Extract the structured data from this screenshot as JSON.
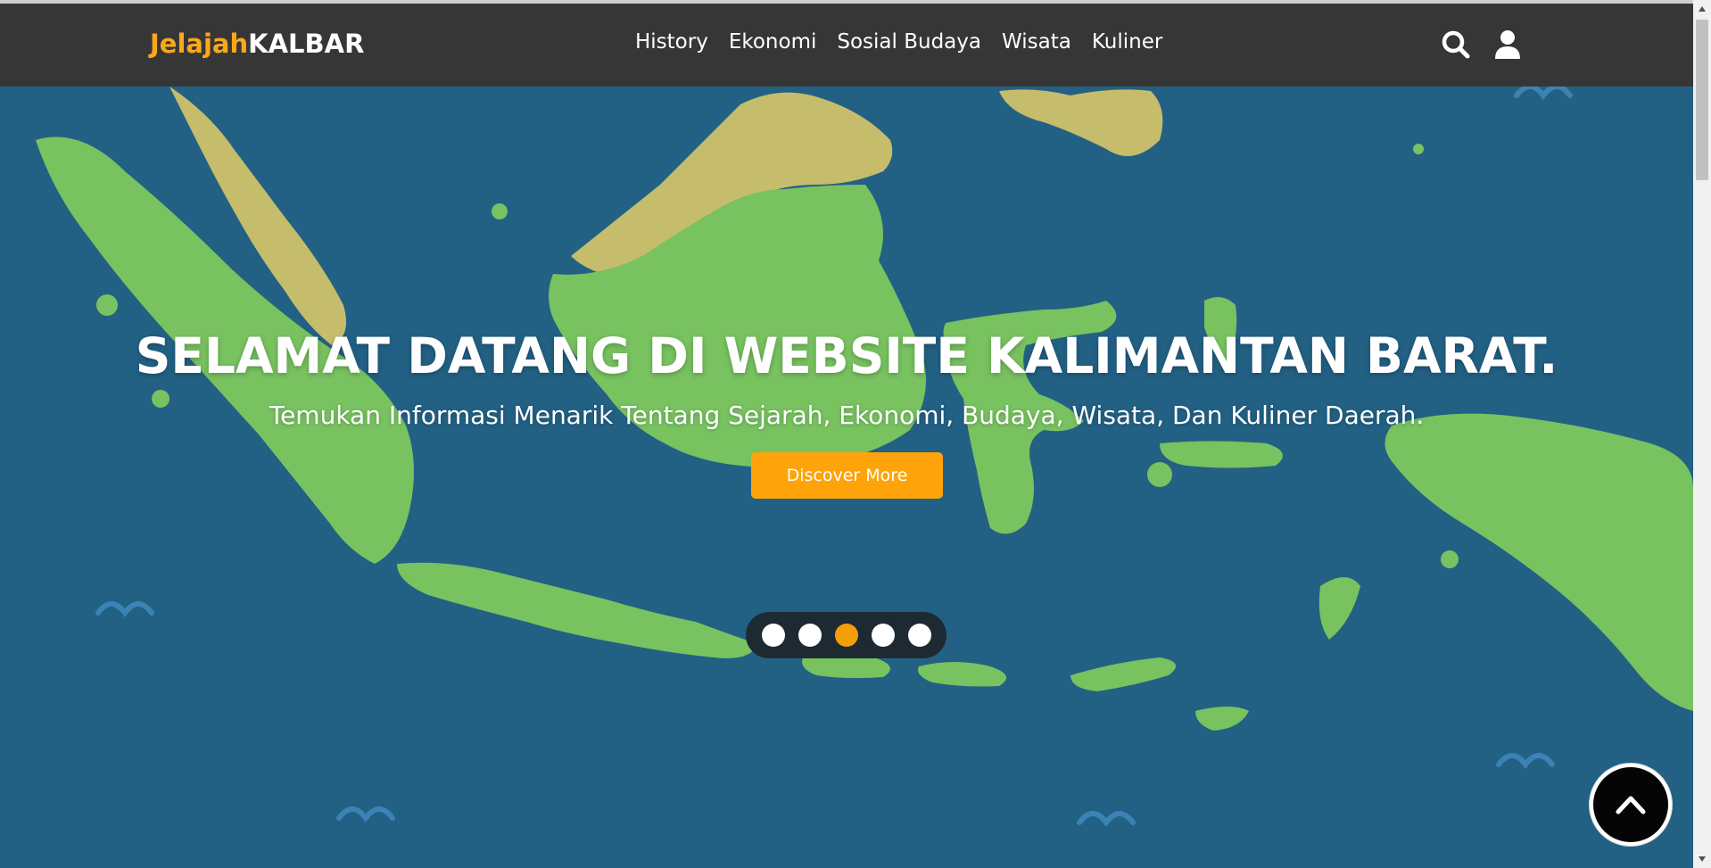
{
  "brand": {
    "part1": "Jelajah",
    "part2": "KALBAR"
  },
  "nav": {
    "links": [
      "History",
      "Ekonomi",
      "Sosial Budaya",
      "Wisata",
      "Kuliner"
    ],
    "search_icon": "search-icon",
    "user_icon": "user-icon"
  },
  "hero": {
    "title": "SELAMAT DATANG DI WEBSITE KALIMANTAN BARAT.",
    "subtitle": "Temukan Informasi Menarik Tentang Sejarah, Ekonomi, Budaya, Wisata, Dan Kuliner Daerah.",
    "cta_label": "Discover More",
    "slides_total": 5,
    "active_slide": 3
  },
  "back_to_top_icon": "chevron-up-icon",
  "colors": {
    "accent": "#f9a81c",
    "navbar": "#363636",
    "sea": "#226184",
    "land": "#78c260",
    "land_foreign": "#c5bd6b",
    "button": "#fea40a"
  }
}
